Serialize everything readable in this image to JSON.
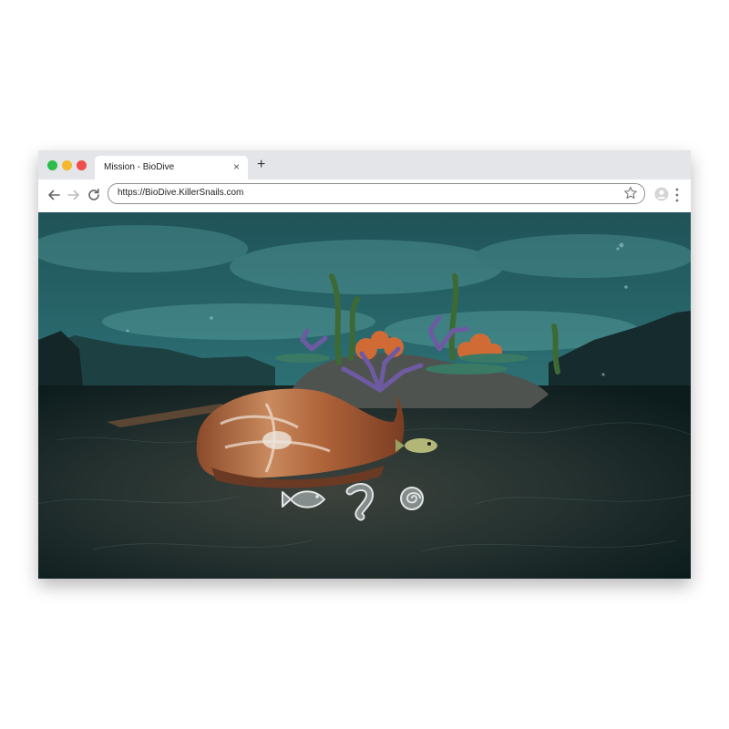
{
  "browser": {
    "tab_title": "Mission - BioDive",
    "tab_close": "×",
    "new_tab": "+",
    "url": "https://BioDive.KillerSnails.com",
    "traffic_light_colors": [
      "#2dbb4a",
      "#f5b72c",
      "#ef4d4a"
    ]
  },
  "game": {
    "scene": "underwater-reef",
    "food_choices": [
      {
        "name": "fish",
        "icon": "fish-icon"
      },
      {
        "name": "worm",
        "icon": "worm-icon"
      },
      {
        "name": "snail",
        "icon": "snail-shell-icon"
      }
    ]
  }
}
